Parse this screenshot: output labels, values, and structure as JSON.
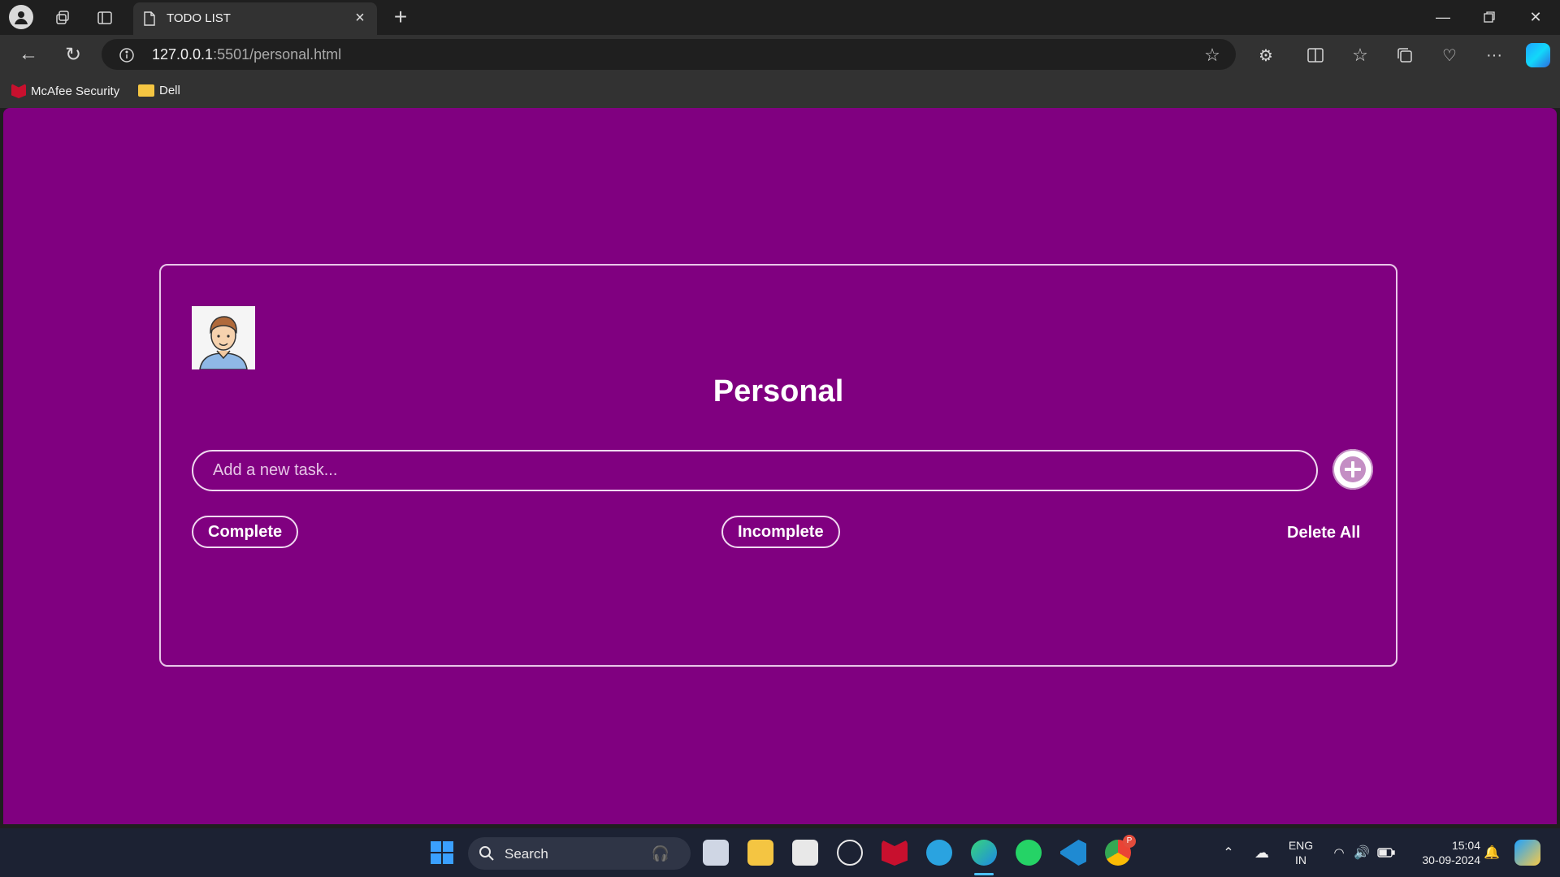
{
  "browser": {
    "tab_title": "TODO LIST",
    "url_host": "127.0.0.1",
    "url_rest": ":5501/personal.html",
    "bookmarks": [
      {
        "label": "McAfee Security",
        "icon": "mcafee-icon"
      },
      {
        "label": "Dell",
        "icon": "folder-icon"
      }
    ]
  },
  "page": {
    "title": "Personal",
    "avatar_icon": "user-avatar-icon",
    "task_input": {
      "placeholder": "Add a new task...",
      "value": ""
    },
    "add_icon": "plus-circle-icon",
    "filters": {
      "complete": "Complete",
      "incomplete": "Incomplete",
      "delete_all": "Delete All"
    },
    "colors": {
      "background": "#800080",
      "accent": "#c48ec4",
      "text": "#ffffff"
    }
  },
  "taskbar": {
    "search_label": "Search",
    "language": "ENG",
    "region": "IN",
    "time": "15:04",
    "date": "30-09-2024",
    "chrome_badge": "P"
  }
}
